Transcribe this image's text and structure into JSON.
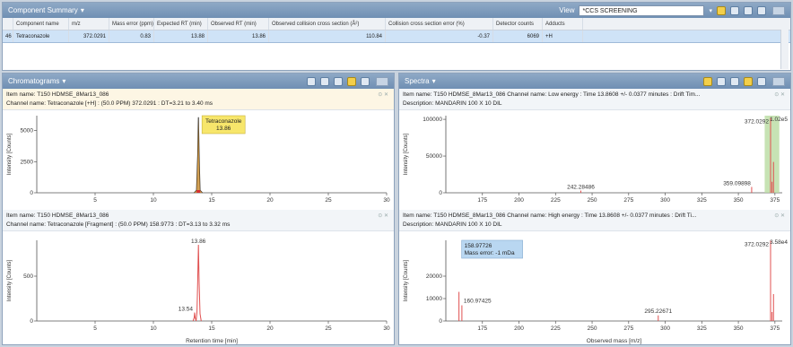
{
  "summary": {
    "title": "Component Summary",
    "view_label": "View",
    "view_value": "*CCS SCREENING",
    "columns": [
      "",
      "Component name",
      "m/z",
      "Mass error (ppm)",
      "Expected RT (min)",
      "Observed RT (min)",
      "Observed collision cross section (Å²)",
      "Collision cross section error (%)",
      "Detector counts",
      "Adducts"
    ],
    "row": {
      "index": "46",
      "name": "Tetraconazole",
      "mz": "372.0291",
      "mass_error": "0.83",
      "expected_rt": "13.88",
      "observed_rt": "13.86",
      "ccs": "110.84",
      "ccs_error": "-0.37",
      "counts": "6069",
      "adducts": "+H"
    }
  },
  "chromatograms": {
    "title": "Chromatograms",
    "plot1": {
      "item_name": "Item name: T150 HDMSE_8Mar13_086",
      "channel_name": "Channel name: Tetraconazole [+H] : (50.0 PPM) 372.0291 : DT=3.21 to 3.40 ms",
      "annotation_name": "Tetraconazole",
      "annotation_value": "13.86"
    },
    "plot2": {
      "item_name": "Item name: T150 HDMSE_8Mar13_086",
      "channel_name": "Channel name: Tetraconazole [Fragment] : (50.0 PPM) 158.9773 : DT=3.13 to 3.32 ms",
      "label_main": "13.86",
      "label_small": "13.54"
    },
    "x_axis_label": "Retention time [min]",
    "y_axis_label": "Intensity [Counts]"
  },
  "spectra": {
    "title": "Spectra",
    "plot1": {
      "item_name": "Item name: T150 HDMSE_8Mar13_086   Channel name: Low energy : Time 13.8608 +/- 0.0377 minutes : Drift Tim...",
      "description": "Description: MANDARIN 100 X 10 DIL",
      "scale_label": "1.02e5",
      "peak_labels": [
        "372.0292",
        "242.28486",
        "359.09898"
      ]
    },
    "plot2": {
      "item_name": "Item name: T150 HDMSE_8Mar13_086   Channel name: High energy : Time 13.8608 +/- 0.0377 minutes : Drift Ti...",
      "description": "Description: MANDARIN 100 X 10 DIL",
      "scale_label": "3.58e4",
      "peak_labels": [
        "372.0292",
        "160.97425",
        "295.22671"
      ],
      "tooltip_mass": "158.97726",
      "tooltip_error": "Mass error: -1 mDa"
    },
    "x_axis_label": "Observed mass [m/z]",
    "y_axis_label": "Intensity [Counts]"
  },
  "chart_data": [
    {
      "type": "line",
      "title": "Tetraconazole [+H] 372.0291",
      "xlabel": "Retention time [min]",
      "ylabel": "Intensity [Counts]",
      "xlim": [
        0,
        30
      ],
      "ylim": [
        0,
        6200
      ],
      "x_ticks": [
        5,
        10,
        15,
        20,
        25,
        30
      ],
      "y_ticks": [
        0,
        2500,
        5000
      ],
      "series": [
        {
          "name": "Tetraconazole",
          "x": [
            13.5,
            13.7,
            13.8,
            13.86,
            13.92,
            14.0,
            14.2
          ],
          "y": [
            0,
            200,
            3000,
            6069,
            3000,
            200,
            0
          ]
        }
      ],
      "color": "#2c2c2c"
    },
    {
      "type": "line",
      "title": "Tetraconazole [Fragment] 158.9773",
      "xlabel": "Retention time [min]",
      "ylabel": "Intensity [Counts]",
      "xlim": [
        0,
        30
      ],
      "ylim": [
        0,
        900
      ],
      "x_ticks": [
        5,
        10,
        15,
        20,
        25,
        30
      ],
      "y_ticks": [
        0,
        500
      ],
      "series": [
        {
          "x": [
            13.4,
            13.5,
            13.54,
            13.58,
            13.66,
            13.74,
            13.8,
            13.86,
            13.92,
            14.0,
            14.1
          ],
          "y": [
            0,
            40,
            95,
            40,
            0,
            100,
            450,
            850,
            420,
            80,
            0
          ]
        }
      ],
      "color": "#e05050"
    },
    {
      "type": "bar",
      "title": "Low energy spectrum",
      "xlabel": "Observed mass [m/z]",
      "ylabel": "Intensity [Counts]",
      "xlim": [
        150,
        380
      ],
      "ylim": [
        0,
        105000
      ],
      "x_ticks": [
        175,
        200,
        225,
        250,
        275,
        300,
        325,
        350,
        375
      ],
      "y_ticks": [
        0,
        50000,
        100000
      ],
      "peaks": [
        [
          242.28486,
          3000
        ],
        [
          359.09898,
          8000
        ],
        [
          372.0292,
          102000
        ],
        [
          374.03,
          42000
        ],
        [
          373.03,
          15000
        ]
      ],
      "highlight": [
        368,
        378
      ],
      "color": "#e05050"
    },
    {
      "type": "bar",
      "title": "High energy spectrum",
      "xlabel": "Observed mass [m/z]",
      "ylabel": "Intensity [Counts]",
      "xlim": [
        150,
        380
      ],
      "ylim": [
        0,
        36000
      ],
      "x_ticks": [
        175,
        200,
        225,
        250,
        275,
        300,
        325,
        350,
        375
      ],
      "y_ticks": [
        0,
        10000,
        20000
      ],
      "peaks": [
        [
          158.97726,
          13000
        ],
        [
          160.97425,
          7000
        ],
        [
          295.22671,
          2500
        ],
        [
          372.0292,
          35800
        ],
        [
          374.03,
          12000
        ],
        [
          373.03,
          4000
        ]
      ],
      "color": "#e05050"
    }
  ]
}
